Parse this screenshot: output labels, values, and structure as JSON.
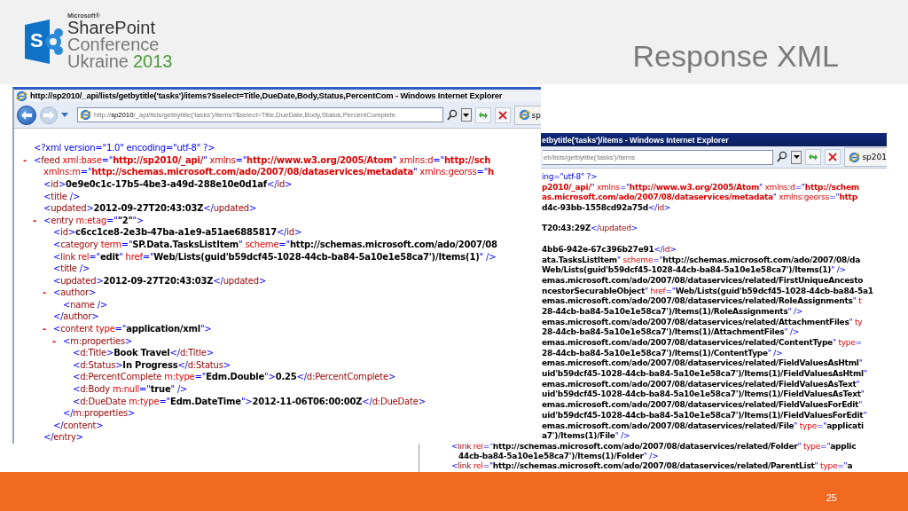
{
  "logo": {
    "letter": "S",
    "maker": "Microsoft®",
    "name": "SharePoint",
    "line_1": "Conference",
    "line_2": "Ukraine",
    "year": "2013"
  },
  "slide_title": "Response XML",
  "front_window": {
    "title": "http://sp2010/_api/lists/getbytitle('tasks')/items?$select=Title,DueDate,Body,Status,PercentCom - Windows Internet Explorer",
    "address": {
      "scheme": "http://",
      "host": "sp2010",
      "path": "/_api/lists/getbytitle('tasks')/items?$select=Title,DueDate,Body,Status,PercentComplete"
    },
    "tab": "sp",
    "xml": [
      {
        "segments": [
          {
            "kind": "markup",
            "text": "<?xml version=\"1.0\" encoding=\"utf-8\" ?>"
          }
        ]
      },
      {
        "toggle": "-",
        "segments": [
          {
            "kind": "markup",
            "text": "<"
          },
          {
            "kind": "name",
            "text": "feed"
          },
          {
            "kind": "attribute",
            "text": " xml:base"
          },
          {
            "kind": "markup",
            "text": "=\""
          },
          {
            "kind": "namespace",
            "text": "http://sp2010/_api/"
          },
          {
            "kind": "markup",
            "text": "\""
          },
          {
            "kind": "attribute",
            "text": " xmlns"
          },
          {
            "kind": "markup",
            "text": "=\""
          },
          {
            "kind": "namespace",
            "text": "http://www.w3.org/2005/Atom"
          },
          {
            "kind": "markup",
            "text": "\""
          },
          {
            "kind": "attribute",
            "text": " xmlns:d"
          },
          {
            "kind": "markup",
            "text": "=\""
          },
          {
            "kind": "namespace",
            "text": "http://sch"
          }
        ],
        "children": [
          {
            "segments": [
              {
                "kind": "attribute",
                "text": "xmlns:m"
              },
              {
                "kind": "markup",
                "text": "=\""
              },
              {
                "kind": "namespace",
                "text": "http://schemas.microsoft.com/ado/2007/08/dataservices/metadata"
              },
              {
                "kind": "markup",
                "text": "\""
              },
              {
                "kind": "attribute",
                "text": " xmlns:georss"
              },
              {
                "kind": "markup",
                "text": "=\""
              },
              {
                "kind": "namespace",
                "text": "h"
              }
            ]
          },
          {
            "segments": [
              {
                "kind": "markup",
                "text": "<"
              },
              {
                "kind": "name",
                "text": "id"
              },
              {
                "kind": "markup",
                "text": ">"
              },
              {
                "kind": "value",
                "text": "0e9e0c1c-17b5-4be3-a49d-288e10e0d1af"
              },
              {
                "kind": "markup",
                "text": "</"
              },
              {
                "kind": "name",
                "text": "id"
              },
              {
                "kind": "markup",
                "text": ">"
              }
            ]
          },
          {
            "segments": [
              {
                "kind": "markup",
                "text": "<"
              },
              {
                "kind": "name",
                "text": "title"
              },
              {
                "kind": "markup",
                "text": " />"
              }
            ]
          },
          {
            "segments": [
              {
                "kind": "markup",
                "text": "<"
              },
              {
                "kind": "name",
                "text": "updated"
              },
              {
                "kind": "markup",
                "text": ">"
              },
              {
                "kind": "value",
                "text": "2012-09-27T20:43:03Z"
              },
              {
                "kind": "markup",
                "text": "</"
              },
              {
                "kind": "name",
                "text": "updated"
              },
              {
                "kind": "markup",
                "text": ">"
              }
            ]
          },
          {
            "toggle": "-",
            "segments": [
              {
                "kind": "markup",
                "text": "<"
              },
              {
                "kind": "name",
                "text": "entry"
              },
              {
                "kind": "attribute",
                "text": " m:etag"
              },
              {
                "kind": "markup",
                "text": "=\""
              },
              {
                "kind": "value",
                "text": "\"2\""
              },
              {
                "kind": "markup",
                "text": "\">"
              }
            ],
            "children": [
              {
                "segments": [
                  {
                    "kind": "markup",
                    "text": "<"
                  },
                  {
                    "kind": "name",
                    "text": "id"
                  },
                  {
                    "kind": "markup",
                    "text": ">"
                  },
                  {
                    "kind": "value",
                    "text": "c6cc1ce8-2e3b-47ba-a1e9-a51ae6885817"
                  },
                  {
                    "kind": "markup",
                    "text": "</"
                  },
                  {
                    "kind": "name",
                    "text": "id"
                  },
                  {
                    "kind": "markup",
                    "text": ">"
                  }
                ]
              },
              {
                "segments": [
                  {
                    "kind": "markup",
                    "text": "<"
                  },
                  {
                    "kind": "name",
                    "text": "category"
                  },
                  {
                    "kind": "attribute",
                    "text": " term"
                  },
                  {
                    "kind": "markup",
                    "text": "=\""
                  },
                  {
                    "kind": "value",
                    "text": "SP.Data.TasksListItem"
                  },
                  {
                    "kind": "markup",
                    "text": "\""
                  },
                  {
                    "kind": "attribute",
                    "text": " scheme"
                  },
                  {
                    "kind": "markup",
                    "text": "=\""
                  },
                  {
                    "kind": "value",
                    "text": "http://schemas.microsoft.com/ado/2007/08"
                  }
                ]
              },
              {
                "segments": [
                  {
                    "kind": "markup",
                    "text": "<"
                  },
                  {
                    "kind": "name",
                    "text": "link"
                  },
                  {
                    "kind": "attribute",
                    "text": " rel"
                  },
                  {
                    "kind": "markup",
                    "text": "=\""
                  },
                  {
                    "kind": "value",
                    "text": "edit"
                  },
                  {
                    "kind": "markup",
                    "text": "\""
                  },
                  {
                    "kind": "attribute",
                    "text": " href"
                  },
                  {
                    "kind": "markup",
                    "text": "=\""
                  },
                  {
                    "kind": "value",
                    "text": "Web/Lists(guid'b59dcf45-1028-44cb-ba84-5a10e1e58ca7')/Items(1)"
                  },
                  {
                    "kind": "markup",
                    "text": "\" />"
                  }
                ]
              },
              {
                "segments": [
                  {
                    "kind": "markup",
                    "text": "<"
                  },
                  {
                    "kind": "name",
                    "text": "title"
                  },
                  {
                    "kind": "markup",
                    "text": " />"
                  }
                ]
              },
              {
                "segments": [
                  {
                    "kind": "markup",
                    "text": "<"
                  },
                  {
                    "kind": "name",
                    "text": "updated"
                  },
                  {
                    "kind": "markup",
                    "text": ">"
                  },
                  {
                    "kind": "value",
                    "text": "2012-09-27T20:43:03Z"
                  },
                  {
                    "kind": "markup",
                    "text": "</"
                  },
                  {
                    "kind": "name",
                    "text": "updated"
                  },
                  {
                    "kind": "markup",
                    "text": ">"
                  }
                ]
              },
              {
                "toggle": "-",
                "segments": [
                  {
                    "kind": "markup",
                    "text": "<"
                  },
                  {
                    "kind": "name",
                    "text": "author"
                  },
                  {
                    "kind": "markup",
                    "text": ">"
                  }
                ],
                "children": [
                  {
                    "segments": [
                      {
                        "kind": "markup",
                        "text": "<"
                      },
                      {
                        "kind": "name",
                        "text": "name"
                      },
                      {
                        "kind": "markup",
                        "text": " />"
                      }
                    ]
                  }
                ]
              },
              {
                "segments": [
                  {
                    "kind": "markup",
                    "text": "</"
                  },
                  {
                    "kind": "name",
                    "text": "author"
                  },
                  {
                    "kind": "markup",
                    "text": ">"
                  }
                ]
              },
              {
                "toggle": "-",
                "segments": [
                  {
                    "kind": "markup",
                    "text": "<"
                  },
                  {
                    "kind": "name",
                    "text": "content"
                  },
                  {
                    "kind": "attribute",
                    "text": " type"
                  },
                  {
                    "kind": "markup",
                    "text": "=\""
                  },
                  {
                    "kind": "value",
                    "text": "application/xml"
                  },
                  {
                    "kind": "markup",
                    "text": "\">"
                  }
                ],
                "children": [
                  {
                    "toggle": "-",
                    "segments": [
                      {
                        "kind": "markup",
                        "text": "<"
                      },
                      {
                        "kind": "name",
                        "text": "m:properties"
                      },
                      {
                        "kind": "markup",
                        "text": ">"
                      }
                    ],
                    "children": [
                      {
                        "segments": [
                          {
                            "kind": "markup",
                            "text": "<"
                          },
                          {
                            "kind": "name",
                            "text": "d:Title"
                          },
                          {
                            "kind": "markup",
                            "text": ">"
                          },
                          {
                            "kind": "value",
                            "text": "Book Travel"
                          },
                          {
                            "kind": "markup",
                            "text": "</"
                          },
                          {
                            "kind": "name",
                            "text": "d:Title"
                          },
                          {
                            "kind": "markup",
                            "text": ">"
                          }
                        ]
                      },
                      {
                        "segments": [
                          {
                            "kind": "markup",
                            "text": "<"
                          },
                          {
                            "kind": "name",
                            "text": "d:Status"
                          },
                          {
                            "kind": "markup",
                            "text": ">"
                          },
                          {
                            "kind": "value",
                            "text": "In Progress"
                          },
                          {
                            "kind": "markup",
                            "text": "</"
                          },
                          {
                            "kind": "name",
                            "text": "d:Status"
                          },
                          {
                            "kind": "markup",
                            "text": ">"
                          }
                        ]
                      },
                      {
                        "segments": [
                          {
                            "kind": "markup",
                            "text": "<"
                          },
                          {
                            "kind": "name",
                            "text": "d:PercentComplete"
                          },
                          {
                            "kind": "attribute",
                            "text": " m:type"
                          },
                          {
                            "kind": "markup",
                            "text": "=\""
                          },
                          {
                            "kind": "value",
                            "text": "Edm.Double"
                          },
                          {
                            "kind": "markup",
                            "text": "\">"
                          },
                          {
                            "kind": "value",
                            "text": "0.25"
                          },
                          {
                            "kind": "markup",
                            "text": "</"
                          },
                          {
                            "kind": "name",
                            "text": "d:PercentComplete"
                          },
                          {
                            "kind": "markup",
                            "text": ">"
                          }
                        ]
                      },
                      {
                        "segments": [
                          {
                            "kind": "markup",
                            "text": "<"
                          },
                          {
                            "kind": "name",
                            "text": "d:Body"
                          },
                          {
                            "kind": "attribute",
                            "text": " m:null"
                          },
                          {
                            "kind": "markup",
                            "text": "=\""
                          },
                          {
                            "kind": "value",
                            "text": "true"
                          },
                          {
                            "kind": "markup",
                            "text": "\" />"
                          }
                        ]
                      },
                      {
                        "segments": [
                          {
                            "kind": "markup",
                            "text": "<"
                          },
                          {
                            "kind": "name",
                            "text": "d:DueDate"
                          },
                          {
                            "kind": "attribute",
                            "text": " m:type"
                          },
                          {
                            "kind": "markup",
                            "text": "=\""
                          },
                          {
                            "kind": "value",
                            "text": "Edm.DateTime"
                          },
                          {
                            "kind": "markup",
                            "text": "\">"
                          },
                          {
                            "kind": "value",
                            "text": "2012-11-06T06:00:00Z"
                          },
                          {
                            "kind": "markup",
                            "text": "</"
                          },
                          {
                            "kind": "name",
                            "text": "d:DueDate"
                          },
                          {
                            "kind": "markup",
                            "text": ">"
                          }
                        ]
                      }
                    ]
                  },
                  {
                    "segments": [
                      {
                        "kind": "markup",
                        "text": "</"
                      },
                      {
                        "kind": "name",
                        "text": "m:properties"
                      },
                      {
                        "kind": "markup",
                        "text": ">"
                      }
                    ]
                  }
                ]
              },
              {
                "segments": [
                  {
                    "kind": "markup",
                    "text": "</"
                  },
                  {
                    "kind": "name",
                    "text": "content"
                  },
                  {
                    "kind": "markup",
                    "text": ">"
                  }
                ]
              }
            ]
          },
          {
            "segments": [
              {
                "kind": "markup",
                "text": "</"
              },
              {
                "kind": "name",
                "text": "entry"
              },
              {
                "kind": "markup",
                "text": ">"
              }
            ]
          }
        ]
      }
    ]
  },
  "back_window": {
    "title": "etbytitle('tasks')/items - Windows Internet Explorer",
    "address": "eb/lists/getbytitle('tasks')/items",
    "tab": "sp201",
    "line_groups": [
      {
        "lines": [
          {
            "segments": [
              {
                "kind": "markup",
                "text": "ing=\"utf-8\" ?>"
              }
            ]
          },
          {
            "segments": [
              {
                "kind": "namespace",
                "text": "p2010/_api/"
              },
              {
                "kind": "markup",
                "text": "\""
              },
              {
                "kind": "attribute",
                "text": " xmlns"
              },
              {
                "kind": "markup",
                "text": "=\""
              },
              {
                "kind": "namespace",
                "text": "http://www.w3.org/2005/Atom"
              },
              {
                "kind": "markup",
                "text": "\""
              },
              {
                "kind": "attribute",
                "text": " xmlns:d"
              },
              {
                "kind": "markup",
                "text": "=\""
              },
              {
                "kind": "namespace",
                "text": "http://schem"
              }
            ]
          },
          {
            "segments": [
              {
                "kind": "namespace",
                "text": "as.microsoft.com/ado/2007/08/dataservices/metadata"
              },
              {
                "kind": "markup",
                "text": "\""
              },
              {
                "kind": "attribute",
                "text": " xmlns:georss"
              },
              {
                "kind": "markup",
                "text": "=\""
              },
              {
                "kind": "namespace",
                "text": "http"
              }
            ]
          },
          {
            "segments": [
              {
                "kind": "value",
                "text": "d4c-93bb-1558cd92a75d"
              },
              {
                "kind": "markup",
                "text": "</"
              },
              {
                "kind": "name",
                "text": "id"
              },
              {
                "kind": "markup",
                "text": ">"
              }
            ]
          }
        ]
      },
      {
        "lines": [
          {
            "segments": [
              {
                "kind": "value",
                "text": "T20:43:29Z"
              },
              {
                "kind": "markup",
                "text": "</"
              },
              {
                "kind": "name",
                "text": "updated"
              },
              {
                "kind": "markup",
                "text": ">"
              }
            ]
          }
        ]
      },
      {
        "lines": [
          {
            "segments": [
              {
                "kind": "value",
                "text": "4bb6-942e-67c396b27e91"
              },
              {
                "kind": "markup",
                "text": "</"
              },
              {
                "kind": "name",
                "text": "id"
              },
              {
                "kind": "markup",
                "text": ">"
              }
            ]
          },
          {
            "segments": [
              {
                "kind": "value",
                "text": "ata.TasksListItem"
              },
              {
                "kind": "markup",
                "text": "\""
              },
              {
                "kind": "attribute",
                "text": " scheme"
              },
              {
                "kind": "markup",
                "text": "=\""
              },
              {
                "kind": "value",
                "text": "http://schemas.microsoft.com/ado/2007/08/da"
              }
            ]
          },
          {
            "segments": [
              {
                "kind": "value",
                "text": "Web/Lists(guid'b59dcf45-1028-44cb-ba84-5a10e1e58ca7')/Items(1)"
              },
              {
                "kind": "markup",
                "text": "\" />"
              }
            ]
          },
          {
            "segments": [
              {
                "kind": "value",
                "text": "emas.microsoft.com/ado/2007/08/dataservices/related/FirstUniqueAncesto"
              }
            ]
          },
          {
            "segments": [
              {
                "kind": "value",
                "text": "ncestorSecurableObject"
              },
              {
                "kind": "markup",
                "text": "\""
              },
              {
                "kind": "attribute",
                "text": " href"
              },
              {
                "kind": "markup",
                "text": "=\""
              },
              {
                "kind": "value",
                "text": "Web/Lists(guid'b59dcf45-1028-44cb-ba84-5a1"
              }
            ]
          },
          {
            "segments": [
              {
                "kind": "value",
                "text": "emas.microsoft.com/ado/2007/08/dataservices/related/RoleAssignments"
              },
              {
                "kind": "markup",
                "text": "\""
              },
              {
                "kind": "attribute",
                "text": " t"
              }
            ]
          },
          {
            "segments": [
              {
                "kind": "value",
                "text": "28-44cb-ba84-5a10e1e58ca7')/Items(1)/RoleAssignments"
              },
              {
                "kind": "markup",
                "text": "\" />"
              }
            ]
          },
          {
            "segments": [
              {
                "kind": "value",
                "text": "emas.microsoft.com/ado/2007/08/dataservices/related/AttachmentFiles"
              },
              {
                "kind": "markup",
                "text": "\""
              },
              {
                "kind": "attribute",
                "text": " ty"
              }
            ]
          },
          {
            "segments": [
              {
                "kind": "value",
                "text": "28-44cb-ba84-5a10e1e58ca7')/Items(1)/AttachmentFiles"
              },
              {
                "kind": "markup",
                "text": "\" />"
              }
            ]
          },
          {
            "segments": [
              {
                "kind": "value",
                "text": "emas.microsoft.com/ado/2007/08/dataservices/related/ContentType"
              },
              {
                "kind": "markup",
                "text": "\""
              },
              {
                "kind": "attribute",
                "text": " type"
              },
              {
                "kind": "markup",
                "text": "="
              }
            ]
          },
          {
            "segments": [
              {
                "kind": "value",
                "text": "28-44cb-ba84-5a10e1e58ca7')/Items(1)/ContentType"
              },
              {
                "kind": "markup",
                "text": "\" />"
              }
            ]
          },
          {
            "segments": [
              {
                "kind": "value",
                "text": "emas.microsoft.com/ado/2007/08/dataservices/related/FieldValuesAsHtml"
              },
              {
                "kind": "markup",
                "text": "\""
              }
            ]
          },
          {
            "segments": [
              {
                "kind": "value",
                "text": "uid'b59dcf45-1028-44cb-ba84-5a10e1e58ca7')/Items(1)/FieldValuesAsHtml"
              },
              {
                "kind": "markup",
                "text": "\""
              }
            ]
          },
          {
            "segments": [
              {
                "kind": "value",
                "text": "emas.microsoft.com/ado/2007/08/dataservices/related/FieldValuesAsText"
              },
              {
                "kind": "markup",
                "text": "\""
              }
            ]
          },
          {
            "segments": [
              {
                "kind": "value",
                "text": "uid'b59dcf45-1028-44cb-ba84-5a10e1e58ca7')/Items(1)/FieldValuesAsText"
              },
              {
                "kind": "markup",
                "text": "\""
              }
            ]
          },
          {
            "segments": [
              {
                "kind": "value",
                "text": "emas.microsoft.com/ado/2007/08/dataservices/related/FieldValuesForEdit"
              },
              {
                "kind": "markup",
                "text": "\""
              }
            ]
          },
          {
            "segments": [
              {
                "kind": "value",
                "text": "uid'b59dcf45-1028-44cb-ba84-5a10e1e58ca7')/Items(1)/FieldValuesForEdit"
              },
              {
                "kind": "markup",
                "text": "\""
              }
            ]
          },
          {
            "segments": [
              {
                "kind": "value",
                "text": "emas.microsoft.com/ado/2007/08/dataservices/related/File"
              },
              {
                "kind": "markup",
                "text": "\""
              },
              {
                "kind": "attribute",
                "text": " type"
              },
              {
                "kind": "markup",
                "text": "=\""
              },
              {
                "kind": "value",
                "text": "applicati"
              }
            ]
          },
          {
            "segments": [
              {
                "kind": "value",
                "text": "a7')/Items(1)/File"
              },
              {
                "kind": "markup",
                "text": "\" />"
              }
            ]
          }
        ]
      }
    ],
    "lower_lines": [
      {
        "segments": [
          {
            "kind": "markup",
            "text": "<"
          },
          {
            "kind": "name",
            "text": "link"
          },
          {
            "kind": "attribute",
            "text": " rel"
          },
          {
            "kind": "markup",
            "text": "=\""
          },
          {
            "kind": "value",
            "text": "http://schemas.microsoft.com/ado/2007/08/dataservices/related/Folder"
          },
          {
            "kind": "markup",
            "text": "\""
          },
          {
            "kind": "attribute",
            "text": " type"
          },
          {
            "kind": "markup",
            "text": "=\""
          },
          {
            "kind": "value",
            "text": "applic"
          }
        ],
        "wrapped_lines": [
          {
            "segments": [
              {
                "kind": "value",
                "text": "44cb-ba84-5a10e1e58ca7')/Items(1)/Folder"
              },
              {
                "kind": "markup",
                "text": "\" />"
              }
            ]
          }
        ]
      },
      {
        "segments": [
          {
            "kind": "markup",
            "text": "<"
          },
          {
            "kind": "name",
            "text": "link"
          },
          {
            "kind": "attribute",
            "text": " rel"
          },
          {
            "kind": "markup",
            "text": "=\""
          },
          {
            "kind": "value",
            "text": "http://schemas.microsoft.com/ado/2007/08/dataservices/related/ParentList"
          },
          {
            "kind": "markup",
            "text": "\""
          },
          {
            "kind": "attribute",
            "text": " type"
          },
          {
            "kind": "markup",
            "text": "=\""
          },
          {
            "kind": "value",
            "text": "a"
          }
        ]
      }
    ]
  },
  "page_number": "25"
}
